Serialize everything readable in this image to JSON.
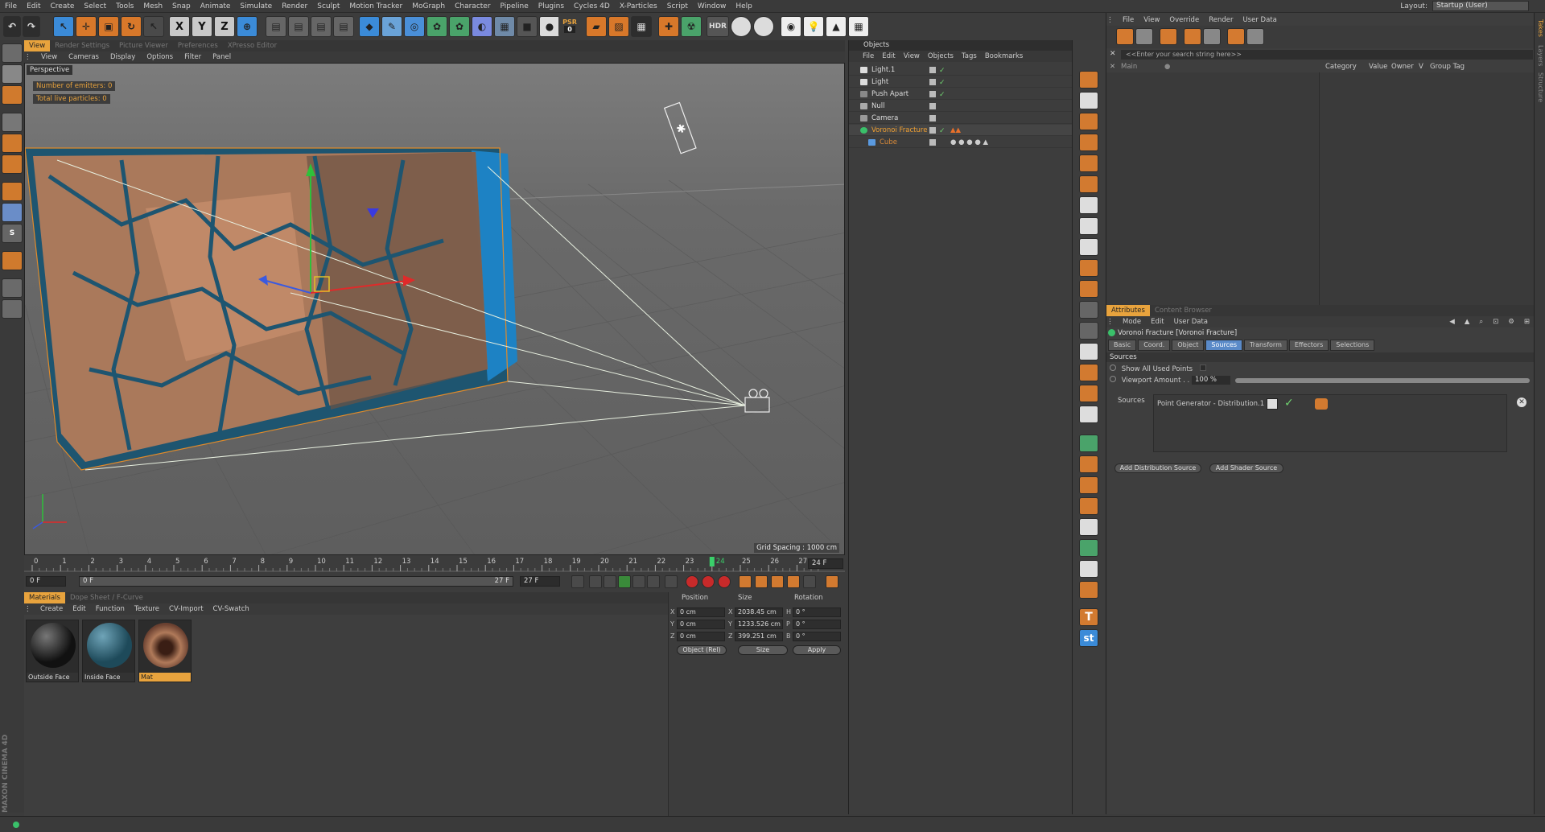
{
  "menubar": {
    "items": [
      "File",
      "Edit",
      "Create",
      "Select",
      "Tools",
      "Mesh",
      "Snap",
      "Animate",
      "Simulate",
      "Render",
      "Sculpt",
      "Motion Tracker",
      "MoGraph",
      "Character",
      "Pipeline",
      "Plugins",
      "Cycles 4D",
      "X-Particles",
      "Script",
      "Window",
      "Help"
    ],
    "layout_label": "Layout:",
    "layout_value": "Startup (User)"
  },
  "toolbar": {
    "axis_x": "X",
    "axis_y": "Y",
    "axis_z": "Z",
    "psr_label": "PSR",
    "psr_value": "0",
    "hdr_label": "HDR"
  },
  "viewport": {
    "panel_tabs": [
      "View",
      "Render Settings",
      "Picture Viewer",
      "Preferences",
      "XPresso Editor"
    ],
    "menu": [
      "View",
      "Cameras",
      "Display",
      "Options",
      "Filter",
      "Panel"
    ],
    "perspective": "Perspective",
    "hud_emitters": "Number of emitters: 0",
    "hud_particles": "Total live particles: 0",
    "grid_spacing": "Grid Spacing : 1000 cm"
  },
  "timeline": {
    "ticks": [
      "0",
      "1",
      "2",
      "3",
      "4",
      "5",
      "6",
      "7",
      "8",
      "9",
      "10",
      "11",
      "12",
      "13",
      "14",
      "15",
      "16",
      "17",
      "18",
      "19",
      "20",
      "21",
      "22",
      "23",
      "24",
      "25",
      "26",
      "27"
    ],
    "current_frame_marker": "24",
    "end_field": "24 F",
    "start_field": "0 F",
    "range_start": "0 F",
    "range_end_inner": "27 F",
    "range_end": "27 F"
  },
  "materials": {
    "tabs": [
      "Materials",
      "Dope Sheet / F-Curve"
    ],
    "menu": [
      "Create",
      "Edit",
      "Function",
      "Texture",
      "CV-Import",
      "CV-Swatch"
    ],
    "items": [
      {
        "name": "Outside Face",
        "selected": false
      },
      {
        "name": "Inside Face",
        "selected": false
      },
      {
        "name": "Mat",
        "selected": true
      }
    ]
  },
  "coordinates": {
    "headers": [
      "Position",
      "Size",
      "Rotation"
    ],
    "rows": [
      {
        "axis": "X",
        "pos": "0 cm",
        "size_axis": "X",
        "size": "2038.45 cm",
        "rot_axis": "H",
        "rot": "0 °"
      },
      {
        "axis": "Y",
        "pos": "0 cm",
        "size_axis": "Y",
        "size": "1233.526 cm",
        "rot_axis": "P",
        "rot": "0 °"
      },
      {
        "axis": "Z",
        "pos": "0 cm",
        "size_axis": "Z",
        "size": "399.251 cm",
        "rot_axis": "B",
        "rot": "0 °"
      }
    ],
    "mode_select": "Object (Rel)",
    "size_select": "Size",
    "apply_label": "Apply"
  },
  "objects": {
    "title": "Objects",
    "menu": [
      "File",
      "Edit",
      "View",
      "Objects",
      "Tags",
      "Bookmarks"
    ],
    "rows": [
      {
        "name": "Light.1",
        "selected": false
      },
      {
        "name": "Light",
        "selected": false
      },
      {
        "name": "Push Apart",
        "selected": false
      },
      {
        "name": "Null",
        "selected": false
      },
      {
        "name": "Camera",
        "selected": false
      },
      {
        "name": "Voronoi Fracture",
        "selected": true
      },
      {
        "name": "Cube",
        "selected": false
      }
    ]
  },
  "layer_manager": {
    "menu": [
      "File",
      "View",
      "Override",
      "Render",
      "User Data"
    ],
    "search_placeholder": "<<Enter your search string here>>",
    "tree_item": "Main",
    "columns": [
      "Category",
      "Value",
      "Owner",
      "V",
      "Group Tag"
    ]
  },
  "attributes": {
    "tabs": [
      "Attributes",
      "Content Browser"
    ],
    "menu": [
      "Mode",
      "Edit",
      "User Data"
    ],
    "title": "Voronoi Fracture [Voronoi Fracture]",
    "subtabs": [
      "Basic",
      "Coord.",
      "Object",
      "Sources",
      "Transform",
      "Effectors",
      "Selections"
    ],
    "active_subtab": "Sources",
    "section": "Sources",
    "show_all_used_points": "Show All Used Points",
    "viewport_amount_label": "Viewport Amount . . .",
    "viewport_amount": "100 %",
    "sources_label": "Sources",
    "source_item": "Point Generator - Distribution.1",
    "add_distribution": "Add Distribution Source",
    "add_shader": "Add Shader Source"
  },
  "side_tabs": [
    "Takes",
    "Layers",
    "Structure"
  ],
  "branding": "MAXON CINEMA 4D",
  "colors": {
    "accent": "#e8a33d",
    "active_tab": "#5a8ac8",
    "selection": "#f0a032"
  }
}
